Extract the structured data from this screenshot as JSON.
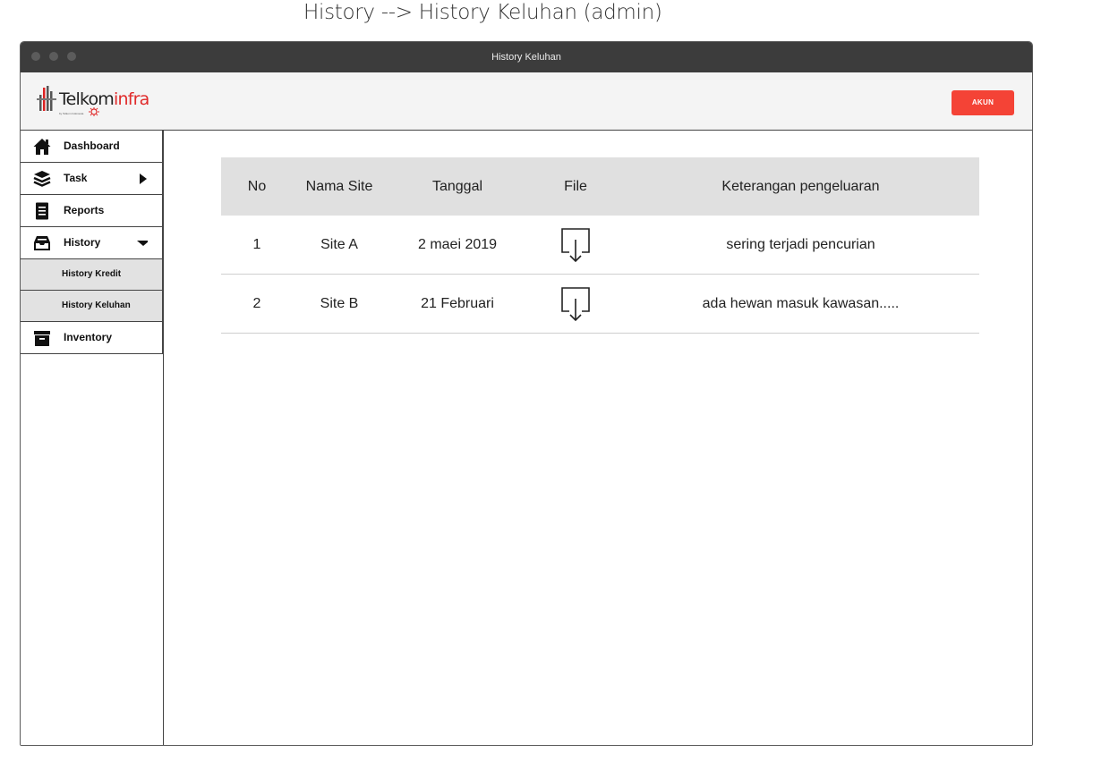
{
  "page_caption": "History --> History Keluhan (admin)",
  "window": {
    "title": "History Keluhan"
  },
  "header": {
    "logo_main": "Telkom",
    "logo_accent": "infra",
    "logo_sub": "by Telkom Indonesia",
    "account_button": "AKUN",
    "accent_color": "#f44336"
  },
  "sidebar": {
    "items": [
      {
        "label": "Dashboard",
        "icon": "home-icon"
      },
      {
        "label": "Task",
        "icon": "layers-icon"
      },
      {
        "label": "Reports",
        "icon": "document-icon"
      },
      {
        "label": "History",
        "icon": "inbox-icon"
      },
      {
        "label": "History Kredit"
      },
      {
        "label": "History Keluhan"
      },
      {
        "label": "Inventory",
        "icon": "archive-icon"
      }
    ]
  },
  "table": {
    "headers": [
      "No",
      "Nama Site",
      "Tanggal",
      "File",
      "Keterangan pengeluaran"
    ],
    "rows": [
      {
        "no": "1",
        "site": "Site A",
        "date": "2 maei 2019",
        "file": "download-icon",
        "note": "sering terjadi pencurian"
      },
      {
        "no": "2",
        "site": "Site B",
        "date": "21 Februari",
        "file": "download-icon",
        "note": "ada hewan masuk kawasan....."
      }
    ]
  }
}
